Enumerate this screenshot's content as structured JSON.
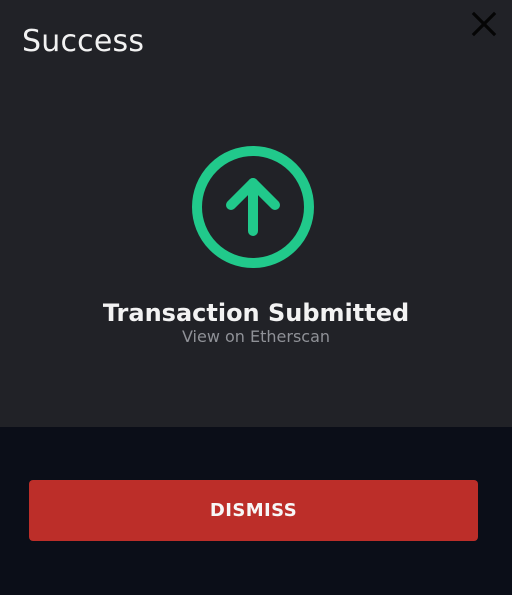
{
  "dialog": {
    "title": "Success",
    "close_icon": "close-icon",
    "status_icon": "arrow-up-circle-icon",
    "status_title": "Transaction Submitted",
    "view_link": "View on Etherscan",
    "dismiss_label": "DISMISS"
  },
  "colors": {
    "panel_background": "#212227",
    "footer_background": "#0b0e18",
    "title_text": "#f2f2f2",
    "status_icon": "#21c98b",
    "link_text": "#8f9197",
    "dismiss_background": "#bc2e29",
    "dismiss_text": "#f7f7f7"
  }
}
